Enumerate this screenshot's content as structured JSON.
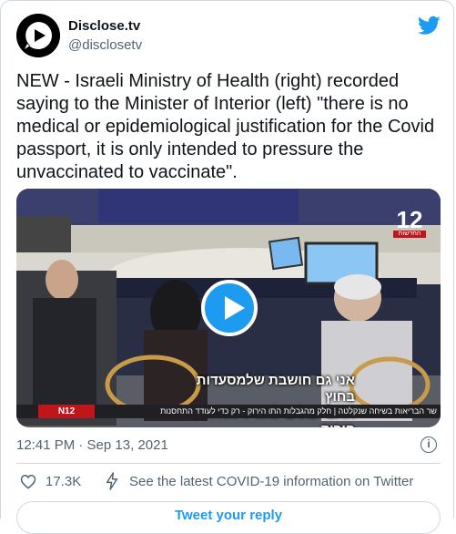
{
  "author": {
    "name": "Disclose.tv",
    "handle": "@disclosetv",
    "avatar_icon": "play-bubble-icon"
  },
  "brand_icon": "twitter-bird-icon",
  "tweet": {
    "text": "NEW - Israeli Ministry of Health (right) recorded saying to the Minister of Interior (left) \"there is no medical or epidemiological justification for the Covid passport, it is only intended to pressure the unvaccinated to vaccinate\"."
  },
  "video": {
    "subtitle_line1": "אני גם חושבת שלמסעדות בחוץ",
    "subtitle_line2": "אתם יכולים להוריד את התו הירוק.",
    "ticker": "שר הבריאות בשיחה שנקלטה | חלק מהגבלות התו הירוק - רק כדי לעודד התחסנות",
    "channel_logo": "N12",
    "channel_badge": "12",
    "channel_badge_caption": "החדשות",
    "play_icon": "play-icon"
  },
  "meta": {
    "timestamp": "12:41 PM · Sep 13, 2021",
    "info_icon": "info-icon"
  },
  "actions": {
    "like_count": "17.3K",
    "covid_info": "See the latest COVID-19 information on Twitter",
    "reply_label": "Tweet your reply"
  },
  "colors": {
    "accent": "#1d9bf0",
    "secondary_text": "#536471",
    "border": "#cfd9de"
  }
}
